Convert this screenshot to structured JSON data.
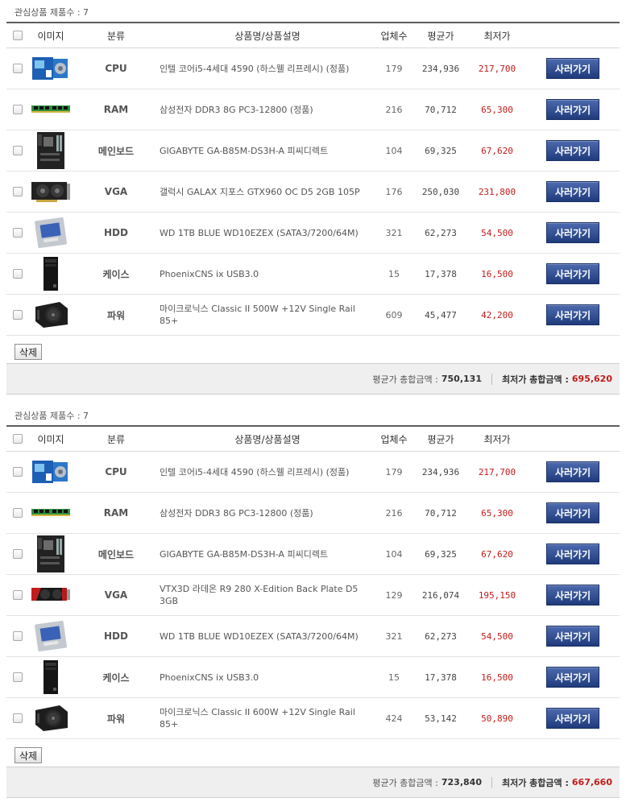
{
  "headers": {
    "image": "이미지",
    "category": "분류",
    "name": "상품명/상품설명",
    "vendors": "업체수",
    "avg": "평균가",
    "low": "최저가"
  },
  "labels": {
    "buy": "사러가기",
    "delete": "삭제",
    "avg_total": "평균가 총합금액 :",
    "low_total": "최저가 총합금액 :"
  },
  "sections": [
    {
      "title": "관심상품 제품수 : 7",
      "items": [
        {
          "category": "CPU",
          "name": "인텔 코어i5-4세대 4590 (하스웰 리프레시) (정품)",
          "vendors": "179",
          "avg": "234,936",
          "low": "217,700",
          "icon": "cpu-box-icon"
        },
        {
          "category": "RAM",
          "name": "삼성전자 DDR3 8G PC3-12800 (정품)",
          "vendors": "216",
          "avg": "70,712",
          "low": "65,300",
          "icon": "ram-stick-icon"
        },
        {
          "category": "메인보드",
          "name": "GIGABYTE GA-B85M-DS3H-A 피씨디렉트",
          "vendors": "104",
          "avg": "69,325",
          "low": "67,620",
          "icon": "motherboard-icon"
        },
        {
          "category": "VGA",
          "name": "갤럭시 GALAX 지포스 GTX960 OC D5 2GB 105P",
          "vendors": "176",
          "avg": "250,030",
          "low": "231,800",
          "icon": "graphics-card-icon"
        },
        {
          "category": "HDD",
          "name": "WD 1TB BLUE WD10EZEX (SATA3/7200/64M)",
          "vendors": "321",
          "avg": "62,273",
          "low": "54,500",
          "icon": "hard-drive-icon"
        },
        {
          "category": "케이스",
          "name": "PhoenixCNS ix USB3.0",
          "vendors": "15",
          "avg": "17,378",
          "low": "16,500",
          "icon": "pc-case-icon"
        },
        {
          "category": "파워",
          "name": "마이크로닉스 Classic II 500W +12V Single Rail 85+",
          "vendors": "609",
          "avg": "45,477",
          "low": "42,200",
          "icon": "power-supply-icon"
        }
      ],
      "avg_total": "750,131",
      "low_total": "695,620"
    },
    {
      "title": "관심상품 제품수 : 7",
      "items": [
        {
          "category": "CPU",
          "name": "인텔 코어i5-4세대 4590 (하스웰 리프레시) (정품)",
          "vendors": "179",
          "avg": "234,936",
          "low": "217,700",
          "icon": "cpu-box-icon"
        },
        {
          "category": "RAM",
          "name": "삼성전자 DDR3 8G PC3-12800 (정품)",
          "vendors": "216",
          "avg": "70,712",
          "low": "65,300",
          "icon": "ram-stick-icon"
        },
        {
          "category": "메인보드",
          "name": "GIGABYTE GA-B85M-DS3H-A 피씨디렉트",
          "vendors": "104",
          "avg": "69,325",
          "low": "67,620",
          "icon": "motherboard-icon"
        },
        {
          "category": "VGA",
          "name": "VTX3D 라데온 R9 280 X-Edition Back Plate D5 3GB",
          "vendors": "129",
          "avg": "216,074",
          "low": "195,150",
          "icon": "graphics-card-red-icon"
        },
        {
          "category": "HDD",
          "name": "WD 1TB BLUE WD10EZEX (SATA3/7200/64M)",
          "vendors": "321",
          "avg": "62,273",
          "low": "54,500",
          "icon": "hard-drive-icon"
        },
        {
          "category": "케이스",
          "name": "PhoenixCNS ix USB3.0",
          "vendors": "15",
          "avg": "17,378",
          "low": "16,500",
          "icon": "pc-case-icon"
        },
        {
          "category": "파워",
          "name": "마이크로닉스 Classic II 600W +12V Single Rail 85+",
          "vendors": "424",
          "avg": "53,142",
          "low": "50,890",
          "icon": "power-supply-icon"
        }
      ],
      "avg_total": "723,840",
      "low_total": "667,660"
    }
  ]
}
